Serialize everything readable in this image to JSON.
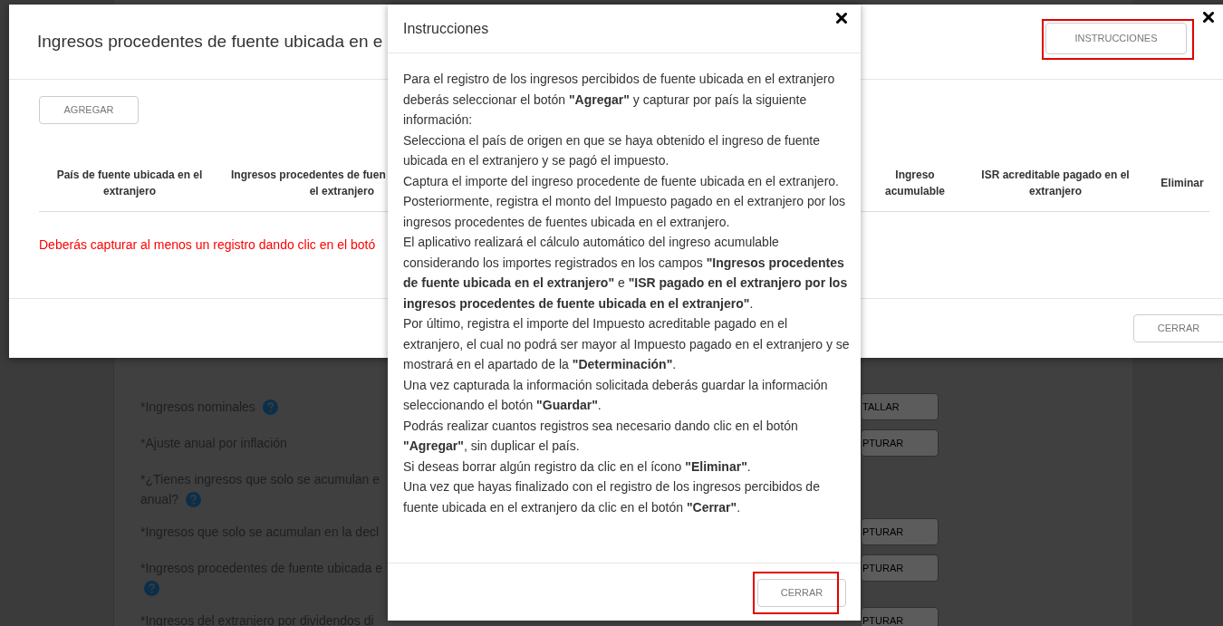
{
  "background_form": {
    "fields": [
      {
        "label": "*Ingresos nominales",
        "help": true,
        "button": "TALLAR"
      },
      {
        "label": "*Ajuste anual por inflación",
        "button": "PTURAR"
      },
      {
        "label": "*¿Tienes ingresos que solo se acumulan e",
        "label_2": "anual?",
        "help": true
      },
      {
        "label": "*Ingresos que solo se acumulan en la decl",
        "button": "PTURAR"
      },
      {
        "label": "*Ingresos procedentes de fuente ubicada e",
        "help": true,
        "help_below": true,
        "button": "PTURAR"
      },
      {
        "label": "*Ingresos del extranjero por dividendos di",
        "button": "PTURAR"
      }
    ]
  },
  "main_dialog": {
    "title": "Ingresos procedentes de fuente ubicada en e",
    "instructions_button": {
      "label": "INSTRUCCIONES",
      "highlighted": true
    },
    "add_button": "AGREGAR",
    "table": {
      "columns": [
        {
          "lines": [
            "País de fuente ubicada en el",
            "extranjero"
          ]
        },
        {
          "lines": [
            "Ingresos procedentes de fuen",
            "el extranjero"
          ]
        },
        {
          "lines": [
            "Ingreso",
            "acumulable"
          ]
        },
        {
          "lines": [
            "ISR acreditable pagado en el",
            "extranjero"
          ]
        },
        {
          "lines": [
            "Eliminar"
          ]
        }
      ]
    },
    "message": "Deberás capturar al menos un registro dando clic en el botó",
    "close_button": {
      "label": "CERRAR"
    }
  },
  "instructions_dialog": {
    "title": "Instrucciones",
    "paragraphs": [
      "Para el registro de los ingresos percibidos de fuente ubicada en el extranjero deberás seleccionar el botón **\"Agregar\"** y capturar por país la siguiente información:",
      "Selecciona el país de origen en que se haya obtenido el ingreso de fuente ubicada en el extranjero y se pagó el impuesto.",
      "Captura el importe del ingreso procedente de fuente ubicada en el extranjero.",
      "Posteriormente, registra el monto del Impuesto pagado en el extranjero por los ingresos procedentes de fuentes ubicada en el extranjero.",
      "El aplicativo realizará el cálculo automático del ingreso acumulable considerando los importes registrados en los campos **\"Ingresos procedentes de fuente ubicada en el extranjero\"** e **\"ISR pagado en el extranjero por los ingresos procedentes de fuente ubicada en el extranjero\"**.",
      "Por último, registra el importe del Impuesto acreditable pagado en el extranjero, el cual no podrá ser mayor al Impuesto pagado en el extranjero y se mostrará en el apartado de la **\"Determinación\"**.",
      "Una vez capturada la información solicitada deberás guardar la información seleccionando el botón **\"Guardar\"**.",
      "Podrás realizar cuantos registros sea necesario dando clic en el botón **\"Agregar\"**, sin duplicar el país.",
      "Si deseas borrar algún registro da clic en el ícono **\"Eliminar\"**.",
      "Una vez que hayas finalizado con el registro de los ingresos percibidos de fuente ubicada en el extranjero da clic en el botón **\"Cerrar\"**."
    ],
    "close_button": {
      "label": "CERRAR",
      "highlighted": true
    }
  }
}
